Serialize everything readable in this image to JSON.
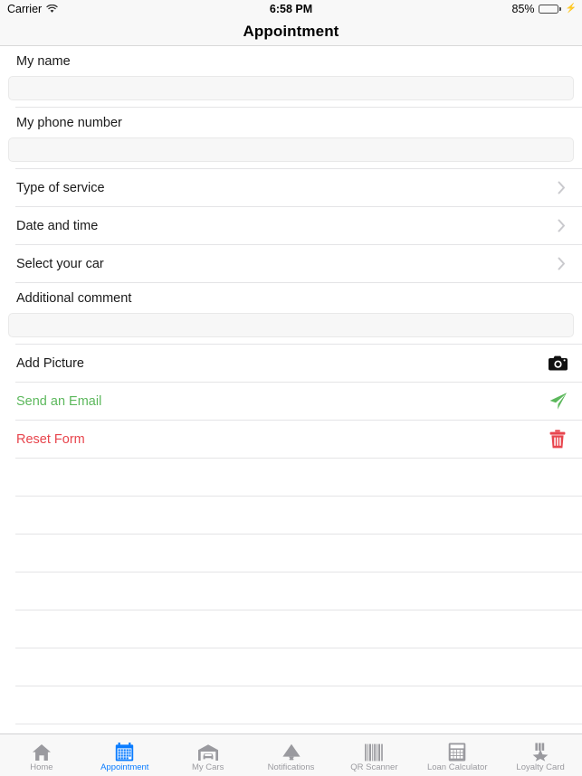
{
  "status_bar": {
    "carrier": "Carrier",
    "wifi_icon": "wifi-icon",
    "time": "6:58 PM",
    "battery_percent": "85%",
    "battery_level": 85,
    "battery_icon": "battery-icon",
    "charging_icon": "lightning-bolt-icon"
  },
  "nav": {
    "title": "Appointment"
  },
  "form": {
    "name": {
      "label": "My name",
      "value": "",
      "placeholder": ""
    },
    "phone": {
      "label": "My phone number",
      "value": "",
      "placeholder": ""
    },
    "comment": {
      "label": "Additional comment",
      "value": "",
      "placeholder": ""
    }
  },
  "nav_rows": [
    {
      "label": "Type of service",
      "icon": "chevron-right-icon"
    },
    {
      "label": "Date and time",
      "icon": "chevron-right-icon"
    },
    {
      "label": "Select your car",
      "icon": "chevron-right-icon"
    }
  ],
  "actions": [
    {
      "label": "Add Picture",
      "icon": "camera-icon",
      "color": "#1a1a1a"
    },
    {
      "label": "Send an Email",
      "icon": "paper-plane-icon",
      "color": "#5cb85c"
    },
    {
      "label": "Reset Form",
      "icon": "trash-icon",
      "color": "#e8454d"
    }
  ],
  "empty_rows": 7,
  "tabs": [
    {
      "label": "Home",
      "icon": "house-icon",
      "active": false
    },
    {
      "label": "Appointment",
      "icon": "calendar-icon",
      "active": true
    },
    {
      "label": "My Cars",
      "icon": "garage-car-icon",
      "active": false
    },
    {
      "label": "Notifications",
      "icon": "megaphone-icon",
      "active": false
    },
    {
      "label": "QR Scanner",
      "icon": "barcode-icon",
      "active": false
    },
    {
      "label": "Loan Calculator",
      "icon": "calculator-icon",
      "active": false
    },
    {
      "label": "Loyalty Card",
      "icon": "loyalty-star-icon",
      "active": false
    }
  ],
  "colors": {
    "accent": "#0a7cff",
    "success": "#5cb85c",
    "danger": "#e8454d",
    "inactive": "#9a9a9f",
    "separator": "#e4e4e6"
  }
}
